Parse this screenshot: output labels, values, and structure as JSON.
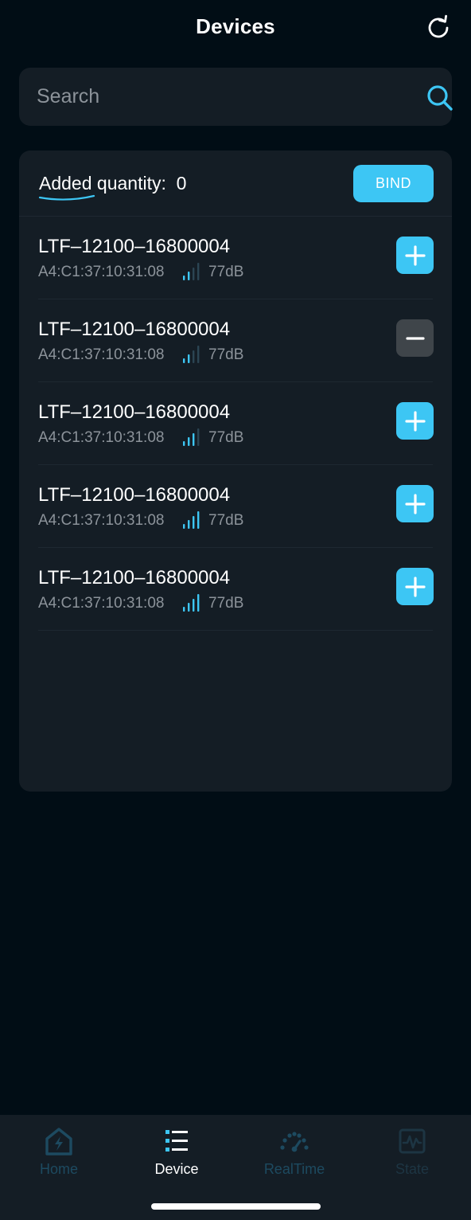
{
  "header": {
    "title": "Devices",
    "refresh_icon": "refresh-icon"
  },
  "search": {
    "placeholder": "Search",
    "value": "",
    "icon": "search-icon"
  },
  "added": {
    "label_underlined": "Added",
    "label_rest": " quantity:",
    "count": "0",
    "bind_label": "BIND"
  },
  "devices": [
    {
      "name": "LTF–12100–16800004",
      "mac": "A4:C1:37:10:31:08",
      "signal": "77dB",
      "signal_bars": 2,
      "action": "add"
    },
    {
      "name": "LTF–12100–16800004",
      "mac": "A4:C1:37:10:31:08",
      "signal": "77dB",
      "signal_bars": 2,
      "action": "remove"
    },
    {
      "name": "LTF–12100–16800004",
      "mac": "A4:C1:37:10:31:08",
      "signal": "77dB",
      "signal_bars": 3,
      "action": "add"
    },
    {
      "name": "LTF–12100–16800004",
      "mac": "A4:C1:37:10:31:08",
      "signal": "77dB",
      "signal_bars": 4,
      "action": "add"
    },
    {
      "name": "LTF–12100–16800004",
      "mac": "A4:C1:37:10:31:08",
      "signal": "77dB",
      "signal_bars": 4,
      "action": "add"
    }
  ],
  "nav": {
    "items": [
      {
        "label": "Home",
        "icon": "home-icon",
        "active": false
      },
      {
        "label": "Device",
        "icon": "device-list-icon",
        "active": true
      },
      {
        "label": "RealTime",
        "icon": "gauge-icon",
        "active": false
      },
      {
        "label": "State",
        "icon": "wave-chart-icon",
        "active": false
      }
    ]
  },
  "colors": {
    "background": "#010d15",
    "card": "#141d25",
    "accent": "#3dc6f4",
    "remove_button": "#3f454a",
    "muted_text": "#8c939a",
    "nav_inactive": "#1d4a60",
    "nav_disabled": "#1d3543"
  }
}
